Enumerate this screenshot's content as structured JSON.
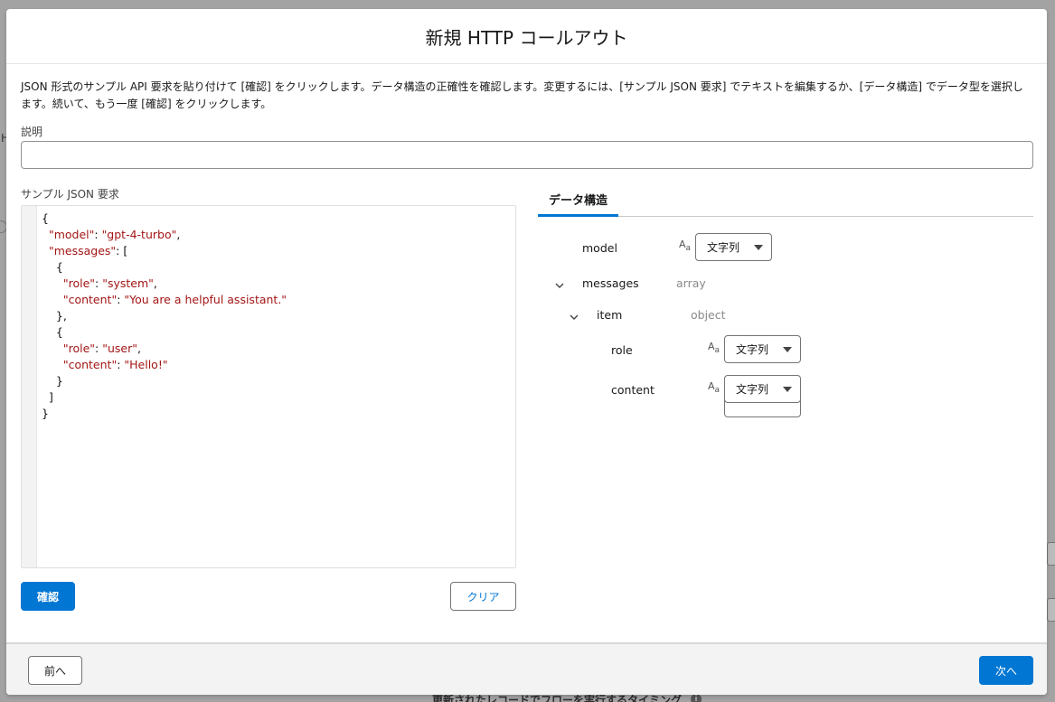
{
  "modal": {
    "title": "新規 HTTP コールアウト",
    "instructions": "JSON 形式のサンプル API 要求を貼り付けて [確認] をクリックします。データ構造の正確性を確認します。変更するには、[サンプル JSON 要求] でテキストを編集するか、[データ構造] でデータ型を選択します。続いて、もう一度 [確認] をクリックします。",
    "description_label": "説明",
    "description_value": "",
    "json_label": "サンプル JSON 要求",
    "confirm_label": "確認",
    "clear_label": "クリア",
    "tab_label": "データ構造",
    "prev_label": "前へ",
    "next_label": "次へ"
  },
  "json_lines": [
    [
      {
        "t": "p",
        "v": "{"
      }
    ],
    [
      {
        "t": "p",
        "v": "  "
      },
      {
        "t": "k",
        "v": "\"model\""
      },
      {
        "t": "p",
        "v": ": "
      },
      {
        "t": "s",
        "v": "\"gpt-4-turbo\""
      },
      {
        "t": "p",
        "v": ","
      }
    ],
    [
      {
        "t": "p",
        "v": "  "
      },
      {
        "t": "k",
        "v": "\"messages\""
      },
      {
        "t": "p",
        "v": ": ["
      }
    ],
    [
      {
        "t": "p",
        "v": "    {"
      }
    ],
    [
      {
        "t": "p",
        "v": "      "
      },
      {
        "t": "k",
        "v": "\"role\""
      },
      {
        "t": "p",
        "v": ": "
      },
      {
        "t": "s",
        "v": "\"system\""
      },
      {
        "t": "p",
        "v": ","
      }
    ],
    [
      {
        "t": "p",
        "v": "      "
      },
      {
        "t": "k",
        "v": "\"content\""
      },
      {
        "t": "p",
        "v": ": "
      },
      {
        "t": "s",
        "v": "\"You are a helpful assistant.\""
      }
    ],
    [
      {
        "t": "p",
        "v": "    },"
      }
    ],
    [
      {
        "t": "p",
        "v": "    {"
      }
    ],
    [
      {
        "t": "p",
        "v": "      "
      },
      {
        "t": "k",
        "v": "\"role\""
      },
      {
        "t": "p",
        "v": ": "
      },
      {
        "t": "s",
        "v": "\"user\""
      },
      {
        "t": "p",
        "v": ","
      }
    ],
    [
      {
        "t": "p",
        "v": "      "
      },
      {
        "t": "k",
        "v": "\"content\""
      },
      {
        "t": "p",
        "v": ": "
      },
      {
        "t": "s",
        "v": "\"Hello!\""
      }
    ],
    [
      {
        "t": "p",
        "v": "    }"
      }
    ],
    [
      {
        "t": "p",
        "v": "  ]"
      }
    ],
    [
      {
        "t": "p",
        "v": "}"
      }
    ]
  ],
  "tree": {
    "model": {
      "name": "model",
      "type_select": "文字列"
    },
    "messages": {
      "name": "messages",
      "type": "array"
    },
    "item": {
      "name": "item",
      "type": "object"
    },
    "role": {
      "name": "role",
      "type_select": "文字列"
    },
    "content": {
      "name": "content",
      "type_select": "文字列"
    }
  },
  "background": {
    "bottom_text": "更新されたレコードでフローを実行するタイミング"
  },
  "colors": {
    "brand": "#0176d3",
    "json_key": "#a31515"
  }
}
